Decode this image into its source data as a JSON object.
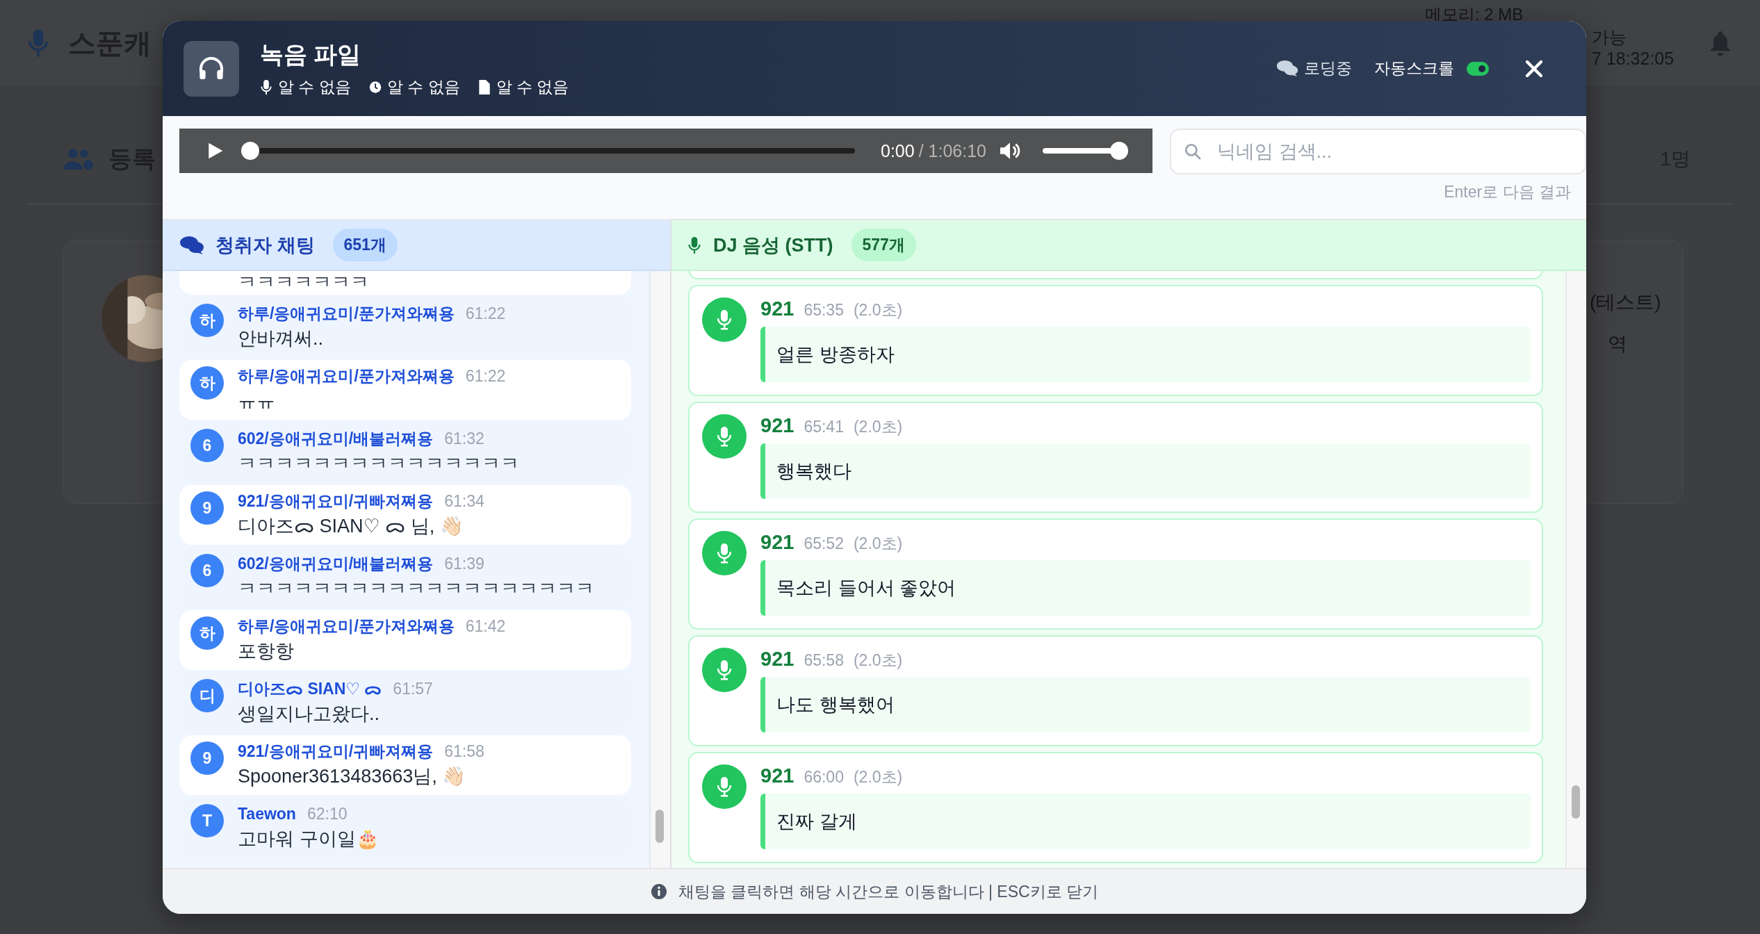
{
  "background": {
    "brand": "스푼캐",
    "memory": "메모리: 2 MB",
    "status": "가능",
    "datetime": "7 18:32:05",
    "section_title": "등록",
    "count": "1명",
    "card_lines": [
      "(테스트)",
      "역"
    ]
  },
  "modal": {
    "title": "녹음 파일",
    "meta": [
      {
        "kind": "mic",
        "text": "알 수 없음"
      },
      {
        "kind": "clock",
        "text": "알 수 없음"
      },
      {
        "kind": "file",
        "text": "알 수 없음"
      }
    ],
    "loading": "로딩중",
    "autoscroll": {
      "label": "자동스크롤",
      "on": true
    }
  },
  "player": {
    "playing": false,
    "level": 0,
    "current": "0:00",
    "duration": "/ 1:06:10",
    "volume": {
      "level": 1
    }
  },
  "search": {
    "placeholder": "닉네임 검색...",
    "hint": "Enter로 다음 결과"
  },
  "chat": {
    "title": "청취자 채팅",
    "count": "651개",
    "messages": [
      {
        "kind": "partial",
        "message": "ㅋㅋㅋㅋㅋㅋㅋ"
      },
      {
        "kind": "full",
        "initial": "하",
        "name": "하루/응애귀요미/푼가져와쪄용",
        "time": "61:22",
        "message": "안바껴써.."
      },
      {
        "kind": "full",
        "initial": "하",
        "name": "하루/응애귀요미/푼가져와쪄용",
        "time": "61:22",
        "message": "ㅠㅠ"
      },
      {
        "kind": "full",
        "initial": "6",
        "name": "602/응애귀요미/배불러쪄용",
        "time": "61:32",
        "message": "ㅋㅋㅋㅋㅋㅋㅋㅋㅋㅋㅋㅋㅋㅋㅋ"
      },
      {
        "kind": "full",
        "initial": "9",
        "name": "921/응애귀요미/귀빠져쪄용",
        "time": "61:34",
        "message": "디아즈ᯅ SIAN♡ ᯅ 님, 👋🏻"
      },
      {
        "kind": "full",
        "initial": "6",
        "name": "602/응애귀요미/배불러쪄용",
        "time": "61:39",
        "message": "ㅋㅋㅋㅋㅋㅋㅋㅋㅋㅋㅋㅋㅋㅋㅋㅋㅋㅋㅋ"
      },
      {
        "kind": "full",
        "initial": "하",
        "name": "하루/응애귀요미/푼가져와쪄용",
        "time": "61:42",
        "message": "포항항"
      },
      {
        "kind": "full",
        "initial": "디",
        "name": "디아즈ᯅ SIAN♡ ᯅ",
        "time": "61:57",
        "message": "생일지나고왔다.."
      },
      {
        "kind": "full",
        "initial": "9",
        "name": "921/응애귀요미/귀빠져쪄용",
        "time": "61:58",
        "message": "Spooner3613483663님, 👋🏻"
      },
      {
        "kind": "full",
        "initial": "T",
        "name": "Taewon",
        "time": "62:10",
        "message": "고마워 구이일🎂"
      }
    ]
  },
  "stt": {
    "title": "DJ 음성 (STT)",
    "count": "577개",
    "entries": [
      {
        "speaker": "921",
        "time": "65:35",
        "duration": "(2.0초)",
        "text": "얼른 방종하자"
      },
      {
        "speaker": "921",
        "time": "65:41",
        "duration": "(2.0초)",
        "text": "행복했다"
      },
      {
        "speaker": "921",
        "time": "65:52",
        "duration": "(2.0초)",
        "text": "목소리 들어서 좋았어"
      },
      {
        "speaker": "921",
        "time": "65:58",
        "duration": "(2.0초)",
        "text": "나도 행복했어"
      },
      {
        "speaker": "921",
        "time": "66:00",
        "duration": "(2.0초)",
        "text": "진짜 갈게"
      }
    ]
  },
  "footer": "채팅을 클릭하면 해당 시간으로 이동합니다 | ESC키로 닫기"
}
